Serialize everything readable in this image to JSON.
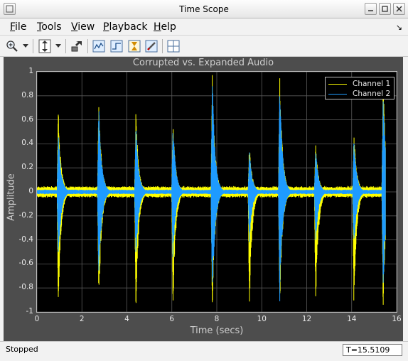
{
  "window": {
    "title": "Time Scope"
  },
  "menu": [
    {
      "mnemonic": "F",
      "rest": "ile"
    },
    {
      "mnemonic": "T",
      "rest": "ools"
    },
    {
      "mnemonic": "V",
      "rest": "iew"
    },
    {
      "mnemonic": "P",
      "rest": "layback"
    },
    {
      "mnemonic": "H",
      "rest": "elp"
    }
  ],
  "menu_right_glyph": "↘",
  "toolbar": {
    "icons": [
      "zoom-in-icon",
      "dropdown-arrow-icon",
      "scale-axes-icon",
      "dropdown-arrow-icon",
      "restore-view-icon",
      "signal-statistics-icon",
      "trigger-icon",
      "peak-finder-icon",
      "data-cursor-icon",
      "layout-icon"
    ]
  },
  "plot": {
    "title": "Corrupted vs. Expanded Audio",
    "xlabel": "Time (secs)",
    "ylabel": "Amplitude"
  },
  "legend": [
    {
      "label": "Channel 1",
      "color": "#ffff00"
    },
    {
      "label": "Channel 2",
      "color": "#1e9bff"
    }
  ],
  "chart_data": {
    "type": "line",
    "title": "Corrupted vs. Expanded Audio",
    "xlabel": "Time (secs)",
    "ylabel": "Amplitude",
    "xlim": [
      0,
      16
    ],
    "ylim": [
      -1,
      1
    ],
    "xticks": [
      "0",
      "2",
      "4",
      "6",
      "8",
      "10",
      "12",
      "14",
      "16"
    ],
    "yticks": [
      "-1",
      "-0.8",
      "-0.6",
      "-0.4",
      "-0.2",
      "0",
      "0.2",
      "0.4",
      "0.6",
      "0.8",
      "1"
    ],
    "grid": true,
    "legend_position": "top-right",
    "background": "#000000",
    "series": [
      {
        "name": "Channel 1",
        "color": "#ffff00",
        "noise_floor": 0.05,
        "bursts": [
          {
            "t": 0.95,
            "peak": 0.7,
            "min": -1.0
          },
          {
            "t": 2.75,
            "peak": 0.8,
            "min": -1.0
          },
          {
            "t": 4.4,
            "peak": 0.68,
            "min": -1.0
          },
          {
            "t": 6.05,
            "peak": 0.6,
            "min": -1.0
          },
          {
            "t": 7.8,
            "peak": 1.0,
            "min": -1.0
          },
          {
            "t": 9.45,
            "peak": 0.41,
            "min": -1.0
          },
          {
            "t": 10.8,
            "peak": 1.0,
            "min": -1.0
          },
          {
            "t": 12.4,
            "peak": 0.41,
            "min": -1.0
          },
          {
            "t": 14.1,
            "peak": 0.53,
            "min": -1.0
          },
          {
            "t": 15.4,
            "peak": 1.0,
            "min": -1.0
          }
        ]
      },
      {
        "name": "Channel 2",
        "color": "#1e9bff",
        "noise_floor": 0.02,
        "bursts": [
          {
            "t": 0.95,
            "peak": 0.52,
            "min": -0.6
          },
          {
            "t": 2.75,
            "peak": 0.75,
            "min": -0.8
          },
          {
            "t": 4.4,
            "peak": 0.56,
            "min": -0.6
          },
          {
            "t": 6.05,
            "peak": 0.59,
            "min": -0.6
          },
          {
            "t": 7.8,
            "peak": 0.98,
            "min": -0.95
          },
          {
            "t": 9.45,
            "peak": 0.36,
            "min": -0.45
          },
          {
            "t": 10.8,
            "peak": 0.93,
            "min": -0.95
          },
          {
            "t": 12.4,
            "peak": 0.36,
            "min": -0.45
          },
          {
            "t": 14.1,
            "peak": 0.46,
            "min": -0.5
          },
          {
            "t": 15.4,
            "peak": 0.85,
            "min": -0.85
          }
        ]
      }
    ]
  },
  "status": {
    "state": "Stopped",
    "time": "T=15.5109"
  }
}
